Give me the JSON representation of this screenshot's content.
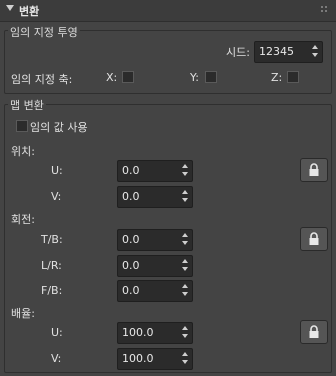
{
  "header": {
    "title": "변환"
  },
  "random_projection": {
    "title": "임의 지정 투영",
    "seed_label": "시드:",
    "seed_value": "12345",
    "axis_label": "임의 지정 축:",
    "axes": [
      {
        "label": "X:"
      },
      {
        "label": "Y:"
      },
      {
        "label": "Z:"
      }
    ]
  },
  "map_transform": {
    "title": "맵 변환",
    "use_random_label": "임의 값 사용",
    "position": {
      "title": "위치:",
      "fields": [
        {
          "label": "U:",
          "value": "0.0"
        },
        {
          "label": "V:",
          "value": "0.0"
        }
      ]
    },
    "rotation": {
      "title": "회전:",
      "fields": [
        {
          "label": "T/B:",
          "value": "0.0"
        },
        {
          "label": "L/R:",
          "value": "0.0"
        },
        {
          "label": "F/B:",
          "value": "0.0"
        }
      ]
    },
    "scale": {
      "title": "배율:",
      "fields": [
        {
          "label": "U:",
          "value": "100.0"
        },
        {
          "label": "V:",
          "value": "100.0"
        }
      ]
    }
  }
}
